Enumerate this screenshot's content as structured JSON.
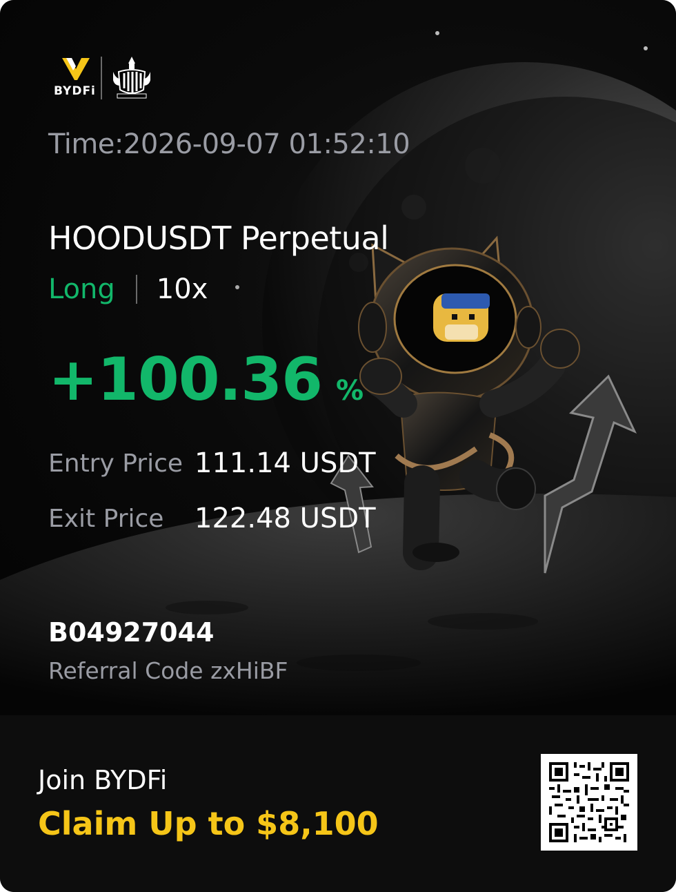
{
  "brand": {
    "name": "BYDFi",
    "partner_logo": "newcastle-united-crest"
  },
  "trade": {
    "time": "Time:2026-09-07 01:52:10",
    "symbol": "HOODUSDT Perpetual",
    "direction": "Long",
    "leverage": "10x",
    "pnl_value": "+100.36",
    "pnl_unit": "%",
    "entry_label": "Entry Price",
    "entry_value": "111.14 USDT",
    "exit_label": "Exit Price",
    "exit_value": "122.48 USDT"
  },
  "user": {
    "uid": "B04927044",
    "referral": "Referral Code zxHiBF"
  },
  "footer": {
    "join": "Join BYDFi",
    "claim": "Claim Up to $8,100"
  },
  "colors": {
    "positive": "#12b76a",
    "accent": "#f5c518",
    "muted": "#9a9ca4",
    "background": "#050505"
  },
  "icons": [
    "bydfi-logo-icon",
    "club-crest-icon",
    "qr-code-icon",
    "astronaut-illustration",
    "moon-illustration",
    "arrow-up-icon"
  ]
}
